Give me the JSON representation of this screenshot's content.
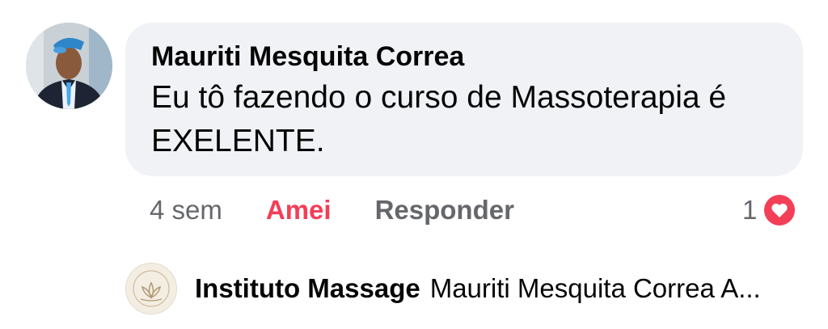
{
  "comment": {
    "author": "Mauriti Mesquita Correa",
    "text": "Eu tô fazendo o curso de Massoterapia é EXELENTE.",
    "time": "4 sem",
    "reaction_label": "Amei",
    "reply_label": "Responder",
    "reaction_count": "1",
    "reaction_icon": "heart-icon",
    "reaction_color": "#f33e58"
  },
  "reply_preview": {
    "author": "Instituto Massage",
    "text": "Mauriti Mesquita Correa A..."
  },
  "colors": {
    "bubble_bg": "#f0f2f5",
    "secondary_text": "#65676b",
    "primary_text": "#050505"
  }
}
